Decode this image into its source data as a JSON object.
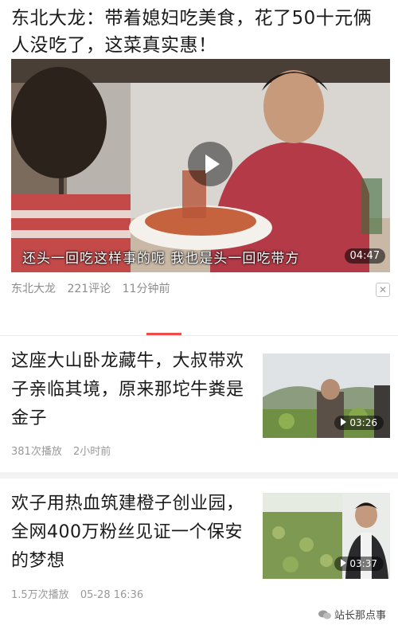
{
  "feed_card": {
    "title": "东北大龙：带着媳妇吃美食，花了50十元俩人没吃了，这菜真实惠！",
    "video": {
      "subtitle": "还头一回吃这样事的呢  我也是头一回吃带方",
      "duration": "04:47",
      "play_icon": "play-icon"
    },
    "meta": {
      "source": "东北大龙",
      "comments": "221评论",
      "time": "11分钟前"
    },
    "close_icon": "close-icon"
  },
  "articles": [
    {
      "title": "这座大山卧龙藏牛，大叔带欢子亲临其境，原来那坨牛粪是金子",
      "plays": "381次播放",
      "time": "2小时前",
      "duration": "03:26"
    },
    {
      "title": "欢子用热血筑建橙子创业园，全网400万粉丝见证一个保安的梦想",
      "plays": "1.5万次播放",
      "time": "05-28 16:36",
      "duration": "03:37"
    }
  ],
  "watermark": {
    "text": "站长那点事",
    "icon": "wechat-icon"
  },
  "colors": {
    "accent": "#f04b4b",
    "meta_text": "#999999"
  }
}
